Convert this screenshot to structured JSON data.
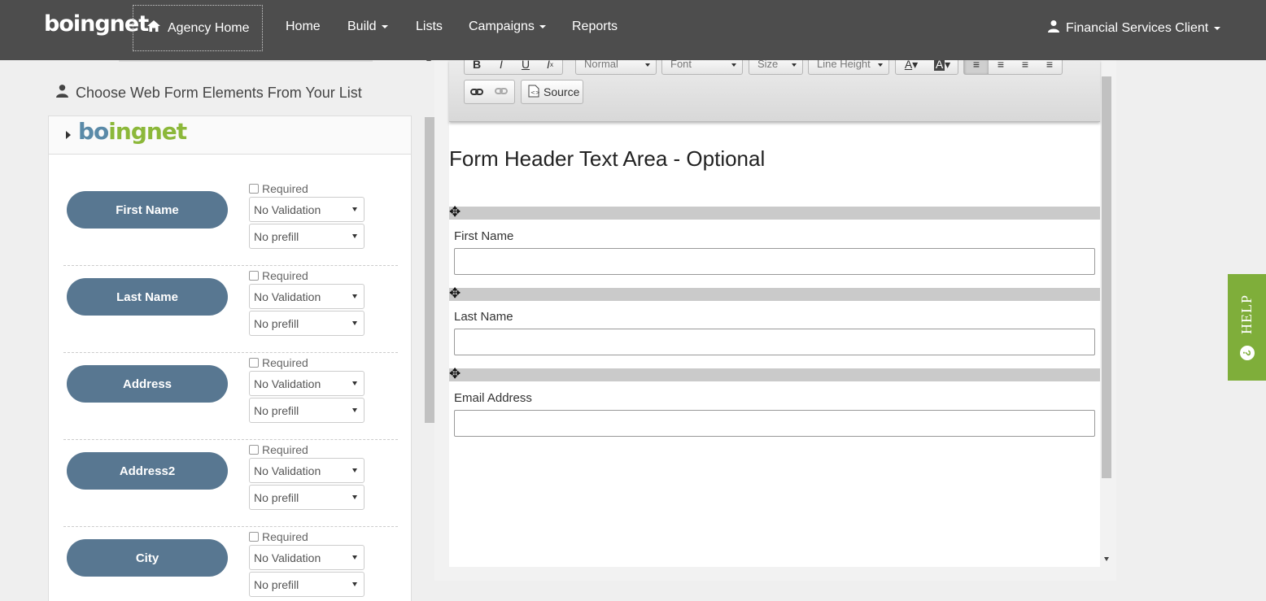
{
  "brand": {
    "logo_text": "boingnet",
    "logo_part1": "bo",
    "logo_part2": "ingnet"
  },
  "nav": {
    "agency_home": "Agency Home",
    "items": [
      {
        "label": "Home",
        "has_caret": false
      },
      {
        "label": "Build",
        "has_caret": true
      },
      {
        "label": "Lists",
        "has_caret": false
      },
      {
        "label": "Campaigns",
        "has_caret": true
      },
      {
        "label": "Reports",
        "has_caret": false
      }
    ],
    "user": "Financial Services Client"
  },
  "left_panel": {
    "heading": "Choose Web Form Elements From Your List",
    "required_label": "Required",
    "fields": [
      {
        "name": "First Name",
        "validation": "No Validation",
        "prefill": "No prefill"
      },
      {
        "name": "Last Name",
        "validation": "No Validation",
        "prefill": "No prefill"
      },
      {
        "name": "Address",
        "validation": "No Validation",
        "prefill": "No prefill"
      },
      {
        "name": "Address2",
        "validation": "No Validation",
        "prefill": "No prefill"
      },
      {
        "name": "City",
        "validation": "No Validation",
        "prefill": "No prefill"
      }
    ]
  },
  "toolbar": {
    "format": "Normal",
    "font": "Font",
    "size": "Size",
    "line_height": "Line Height",
    "source": "Source"
  },
  "editor": {
    "title": "Form Header Text Area - Optional",
    "fields": [
      "First Name",
      "Last Name",
      "Email Address"
    ]
  },
  "help": {
    "label": "HELP",
    "icon": "?"
  }
}
